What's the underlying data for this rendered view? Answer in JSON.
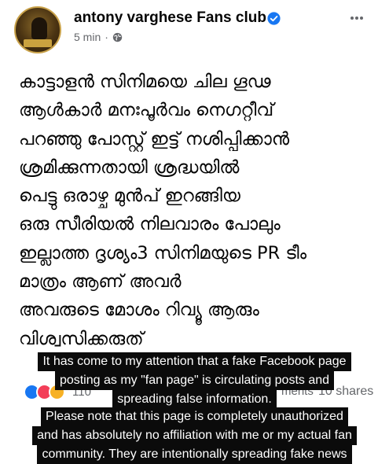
{
  "post": {
    "page_name": "antony varghese Fans club",
    "time": "5 min",
    "dot": "·",
    "body_lines": [
      "കാട്ടാളൻ സിനിമയെ ചില ഗൂഢ",
      "ആൾകാർ മനഃപൂർവം നെഗറ്റീവ്",
      "പറഞ്ഞു പോസ്റ്റ്‌ ഇട്ട് നശിപ്പിക്കാൻ",
      "ശ്രമിക്കുന്നതായി ശ്രദ്ധയിൽ",
      "പെട്ടു  ഒരാഴ്ച മുൻപ് ഇറങ്ങിയ",
      "ഒരു സീരിയൽ നിലവാരം പോലും",
      "ഇല്ലാത്ത ദൃശ്യം3  സിനിമയുടെ PR ടീം",
      "മാത്രം ആണ് അവർ",
      "അവരുടെ മോശം റിവ്യൂ ആരും",
      "വിശ്വസിക്കരുത്"
    ],
    "reaction_count": "110",
    "comments_count": "ments",
    "shares_count": "10 shares"
  },
  "overlay": {
    "lines": [
      "It has come to my attention that a fake Facebook page",
      "posting as my \"fan page\" is circulating posts and",
      "spreading false information.",
      "Please note that this page is completely unauthorized",
      "and has absolutely no affiliation with me or my actual fan",
      "community. They are intentionally spreading fake news"
    ]
  },
  "colors": {
    "verified": "#1877f2",
    "secondary_text": "#65676b",
    "caption_bg": "#0b0b0b"
  },
  "icons": {
    "verified": "verified-badge-icon",
    "globe": "globe-icon",
    "more": "more-options-icon"
  }
}
